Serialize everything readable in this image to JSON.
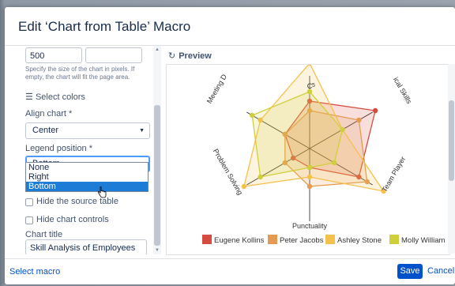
{
  "dialog": {
    "title": "Edit ‘Chart from Table’ Macro"
  },
  "left": {
    "width_value": "500",
    "width_hint": "Specify the size of the chart in pixels. If empty, the chart will fit the page area.",
    "select_colors": "Select colors",
    "align_label": "Align chart *",
    "align_value": "Center",
    "legend_label": "Legend position *",
    "legend_value": "Bottom",
    "legend_options": [
      "None",
      "Right",
      "Bottom"
    ],
    "hide_source": "Hide the source table",
    "hide_controls": "Hide chart controls",
    "chart_title_label": "Chart title",
    "chart_title_value": "Skill Analysis of Employees"
  },
  "preview": {
    "heading": "Preview"
  },
  "footer": {
    "select_macro": "Select macro",
    "save": "Save",
    "cancel": "Cancel"
  },
  "chart_data": {
    "type": "radar",
    "axes": [
      "Technical Skills",
      "Team Player",
      "Punctuality",
      "Problem Solving",
      "Meeting Deadlines",
      "Communication"
    ],
    "axis_labels_visible": [
      "ical Skills",
      "Team Player",
      "Punctuality",
      "Problem Solving",
      "Meeting D",
      "C"
    ],
    "scale_tick": "5",
    "series": [
      {
        "name": "Eugene Kollins",
        "color": "#d64b3f",
        "values": [
          8,
          6,
          2,
          2,
          3,
          5
        ]
      },
      {
        "name": "Peter Jacobs",
        "color": "#e59a52",
        "values": [
          6,
          7,
          4,
          3,
          3,
          4
        ]
      },
      {
        "name": "Ashley Stone",
        "color": "#f5c14d",
        "values": [
          4,
          9,
          3,
          8,
          6,
          9
        ]
      },
      {
        "name": "Molly William",
        "color": "#cfcf3c",
        "values": [
          4,
          3,
          2,
          6,
          7,
          6
        ]
      }
    ]
  }
}
